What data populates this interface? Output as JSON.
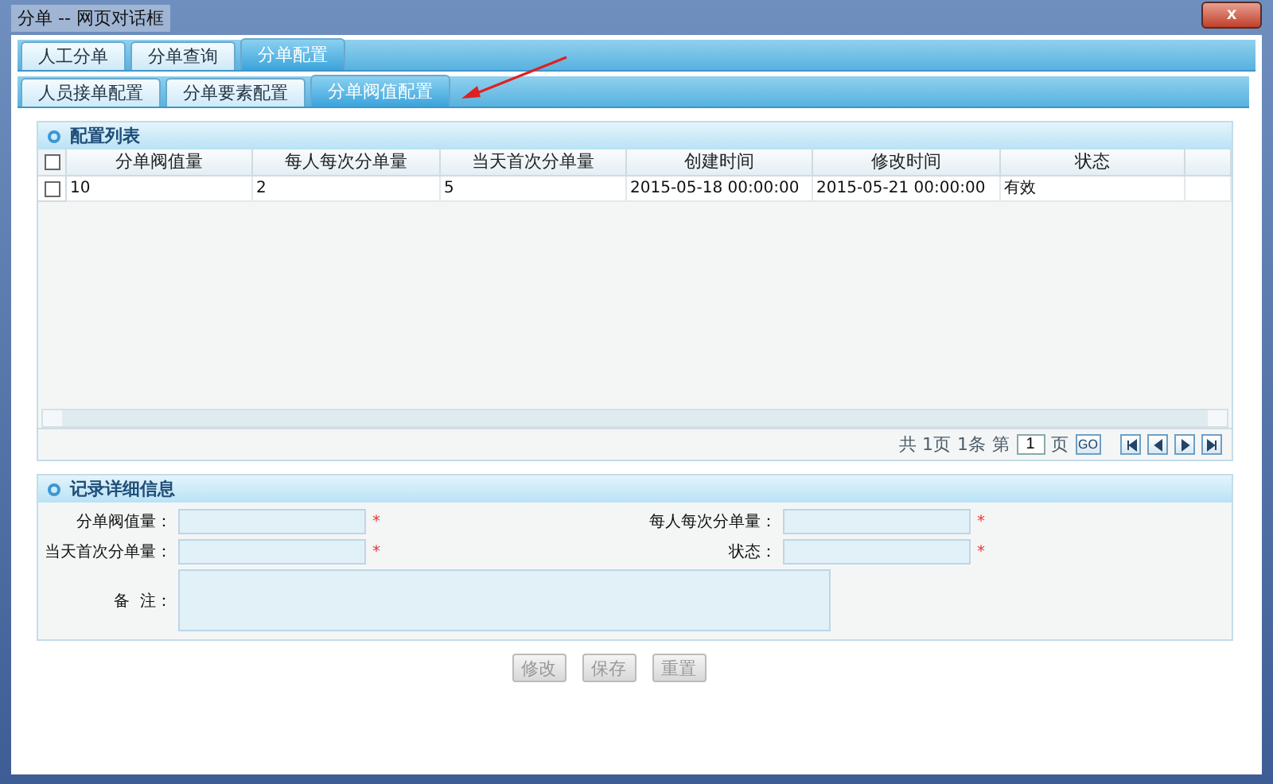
{
  "window": {
    "title": "分单 -- 网页对话框",
    "close": "x"
  },
  "tabs": [
    {
      "label": "人工分单",
      "selected": false
    },
    {
      "label": "分单查询",
      "selected": false
    },
    {
      "label": "分单配置",
      "selected": true
    }
  ],
  "subtabs": [
    {
      "label": "人员接单配置",
      "selected": false
    },
    {
      "label": "分单要素配置",
      "selected": false
    },
    {
      "label": "分单阀值配置",
      "selected": true
    }
  ],
  "list_panel": {
    "title": "配置列表",
    "table": {
      "select_all_checked": false,
      "columns": [
        "分单阀值量",
        "每人每次分单量",
        "当天首次分单量",
        "创建时间",
        "修改时间",
        "状态"
      ],
      "rows": [
        {
          "checked": false,
          "cells": [
            "10",
            "2",
            "5",
            "2015-05-18 00:00:00",
            "2015-05-21 00:00:00",
            "有效"
          ]
        }
      ]
    },
    "pager": {
      "total_pages": "共 1页",
      "total_records": "1条",
      "page_prefix": "第",
      "page_value": "1",
      "page_suffix": "页",
      "go": "GO"
    }
  },
  "detail_panel": {
    "title": "记录详细信息",
    "fields": [
      {
        "label": "分单阀值量：",
        "required": true,
        "mark": "*"
      },
      {
        "label": "每人每次分单量：",
        "required": true,
        "mark": "*"
      },
      {
        "label": "当天首次分单量：",
        "required": true,
        "mark": "*"
      },
      {
        "label": "状态：",
        "required": true,
        "mark": "*"
      }
    ],
    "remark": {
      "label": "备  注："
    }
  },
  "buttons": [
    {
      "label": "修改",
      "disabled": true
    },
    {
      "label": "保存",
      "disabled": true
    },
    {
      "label": "重置",
      "disabled": true
    }
  ]
}
